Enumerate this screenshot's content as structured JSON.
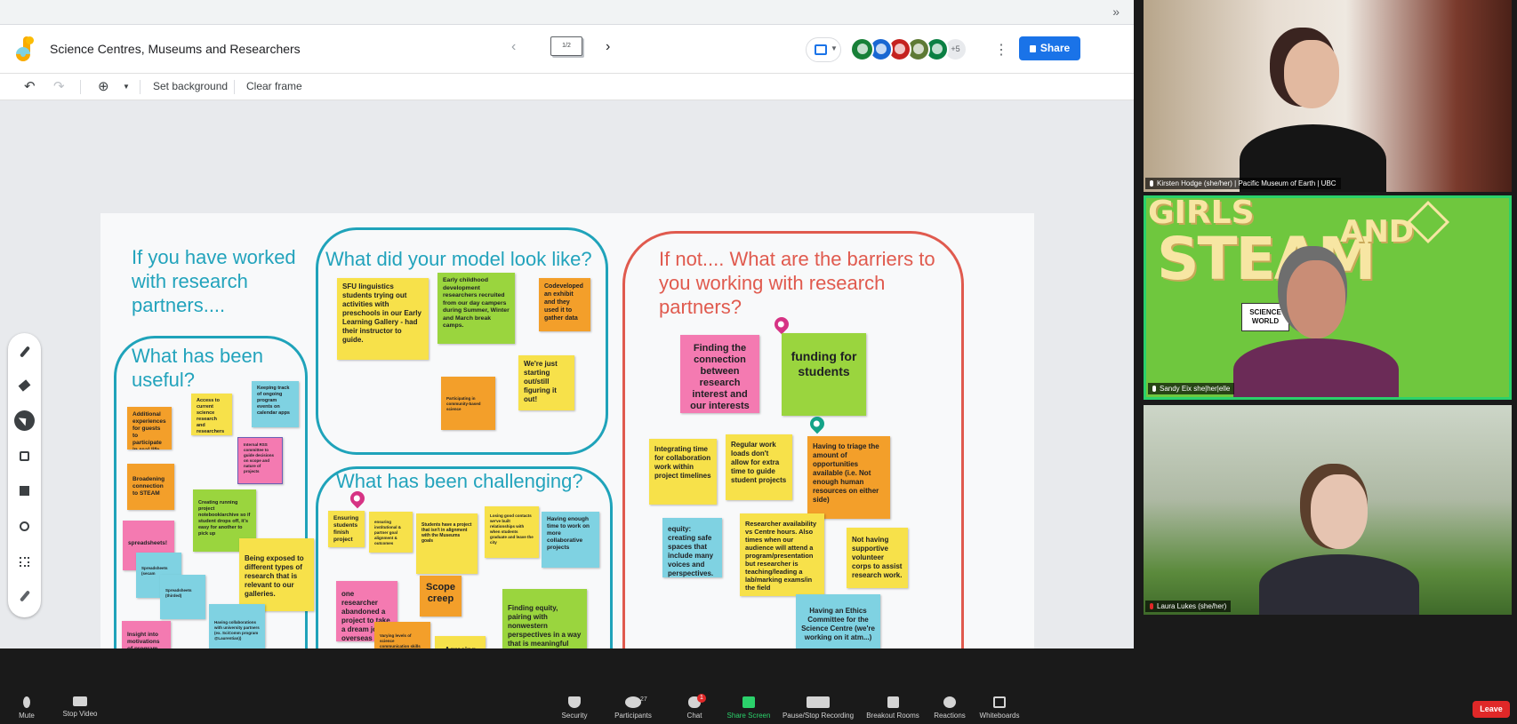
{
  "jamboard": {
    "title": "Science Centres, Museums and Researchers",
    "frame_indicator": "1/2",
    "share_label": "Share",
    "avatars_more": "+5",
    "avatar_colors": [
      "#188038",
      "#1967d2",
      "#c5221f",
      "#5e7a34",
      "#0b8043"
    ],
    "toolbar": {
      "set_background": "Set background",
      "clear_frame": "Clear frame"
    },
    "board": {
      "headings": {
        "worked": "If you have worked with research partners....",
        "model": "What did your model look like?",
        "useful": "What has been useful?",
        "challenging": "What has been challenging?",
        "barriers": "If not.... What are the barriers to you working with research partners?"
      },
      "model_notes": [
        "SFU linguistics students trying out activities with preschools in our Early Learning Gallery - had their instructor to guide.",
        "Early childhood development researchers recruited from our day campers during Summer, Winter and March break camps.",
        "Codeveloped an exhibit and they used it to gather data",
        "We're just starting out/still figuring it out!",
        "Participating in community-based science"
      ],
      "useful_notes": [
        "Additional experiences for guests to participate in real life science!",
        "Access to current science research and researchers",
        "Keeping track of ongoing program events on calendar apps",
        "Internal RSS committee to guide decisions on scope and nature of projects",
        "Broadening connection to STEAM",
        "Creating running project notebook/archive so if student drops off, it's easy for another to pick up",
        "spreadsheets!",
        "Spreadsheets (secam",
        "Spreadsheets (thirded)",
        "Being exposed to different types of research that is relevant to our galleries.",
        "Having collaborations with university partners (ex. SciComm program @Laurentian))",
        "Insight into motivations of program participants"
      ],
      "challenging_notes": [
        "Ensuring students finish project",
        "ensuring institutional & partner goal alignment & outcomes",
        "Students have a project that isn't in alignment with the Museums goals",
        "Losing good contacts we've built relationships with when students graduate and leave the city",
        "Having enough time to work on more collaborative projects",
        "one researcher abandoned a project to take a dream job overseas",
        "Scope creep",
        "Varying levels of science communication skills for researchers/students",
        "Agreeing on Project Scope",
        "Finding equity, pairing with nonwestern perspectives in a way that is meaningful and avoiding tokenism."
      ],
      "barrier_notes": [
        "Finding the connection between research interest and our interests",
        "funding for students",
        "Integrating time for collaboration work within project timelines",
        "Regular work loads don't allow for extra time to guide student projects",
        "Having to triage the amount of opportunities available (i.e. Not enough human resources on either side)",
        "equity: creating safe spaces that include many voices and perspectives.",
        "Researcher availability vs Centre hours. Also times when our audience will attend a program/presentation but researcher is teaching/leading a lab/marking exams/in the field",
        "Not having supportive volunteer corps to assist research work.",
        "Having an Ethics Committee for the Science Centre (we're working on it atm...)"
      ]
    }
  },
  "participants": [
    {
      "name": "Kirsten Hodge (she/her) | Pacific Museum of Earth | UBC"
    },
    {
      "name": "Sandy Eix she|her|elle",
      "banner_top": "GIRLS",
      "banner_mid": "STEAM",
      "banner_and": "AND",
      "sign": "SCIENCE WORLD"
    },
    {
      "name": "Laura Lukes (she/her)"
    }
  ],
  "zoom_controls": [
    {
      "label": "Mute"
    },
    {
      "label": "Stop Video"
    },
    {
      "label": "Security"
    },
    {
      "label": "Participants",
      "count": "27"
    },
    {
      "label": "Chat",
      "badge": "1"
    },
    {
      "label": "Share Screen"
    },
    {
      "label": "Pause/Stop Recording"
    },
    {
      "label": "Breakout Rooms"
    },
    {
      "label": "Reactions"
    },
    {
      "label": "Whiteboards"
    }
  ],
  "leave_label": "Leave",
  "colors": {
    "teal_region": "#1fa3ba",
    "red_region": "#e05a4e",
    "share_blue": "#1a73e8",
    "zoom_green": "#2bd16b",
    "leave_red": "#e02828"
  },
  "icons": [
    "undo-icon",
    "redo-icon",
    "zoom-icon",
    "pen-icon",
    "eraser-icon",
    "select-icon",
    "sticky-note-icon",
    "image-icon",
    "circle-icon",
    "text-box-icon",
    "laser-icon",
    "mic-icon",
    "video-icon",
    "security-icon",
    "participants-icon",
    "chat-icon",
    "share-screen-icon",
    "record-icon",
    "breakout-icon",
    "reactions-icon",
    "whiteboard-icon"
  ]
}
